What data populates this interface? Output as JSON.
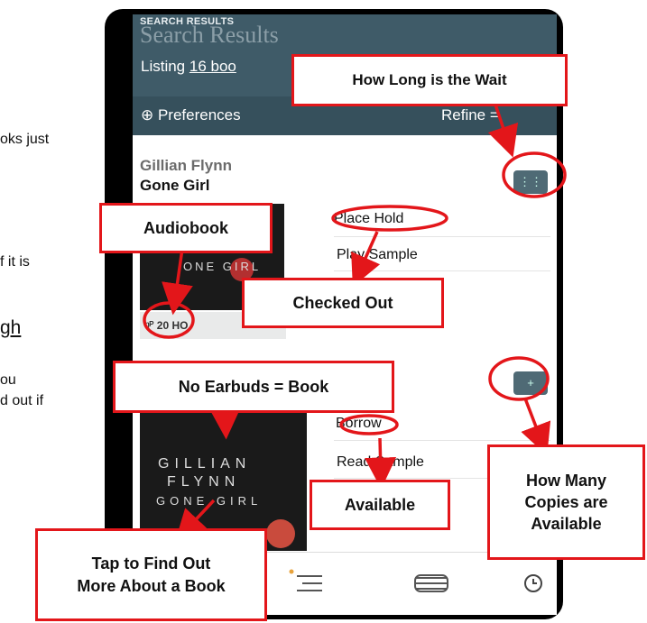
{
  "background_text": {
    "line1": "oks just",
    "line2": "f it is",
    "line3": "gh",
    "line4": "ou",
    "line5": "d out if"
  },
  "app": {
    "header_small": "SEARCH RESULTS",
    "header_ghost": "Search Results",
    "listing_prefix": "Listing ",
    "listing_link": "16 boo",
    "preferences": "⊕ Preferences",
    "refine": "Refine ="
  },
  "books": [
    {
      "author": "Gillian Flynn",
      "title": "Gone Girl",
      "cover_text": "ONE GIRL",
      "format_label": "20 HO",
      "actions": [
        "Place Hold",
        "Play Sample"
      ]
    },
    {
      "cover_author_line1": "GILLIAN",
      "cover_author_line2": "FLYNN",
      "cover_title": "GONE GIRL",
      "actions": [
        "Borrow",
        "Read Sample"
      ]
    }
  ],
  "annotations": {
    "wait": "How Long is the Wait",
    "audiobook": "Audiobook",
    "checked_out": "Checked Out",
    "no_earbuds": "No Earbuds = Book",
    "available": "Available",
    "copies_line1": "How Many",
    "copies_line2": "Copies are",
    "copies_line3": "Available",
    "tap_line1": "Tap to Find Out",
    "tap_line2": "More About a Book"
  },
  "colors": {
    "header": "#3f5b68",
    "annotation_red": "#e3161a"
  }
}
